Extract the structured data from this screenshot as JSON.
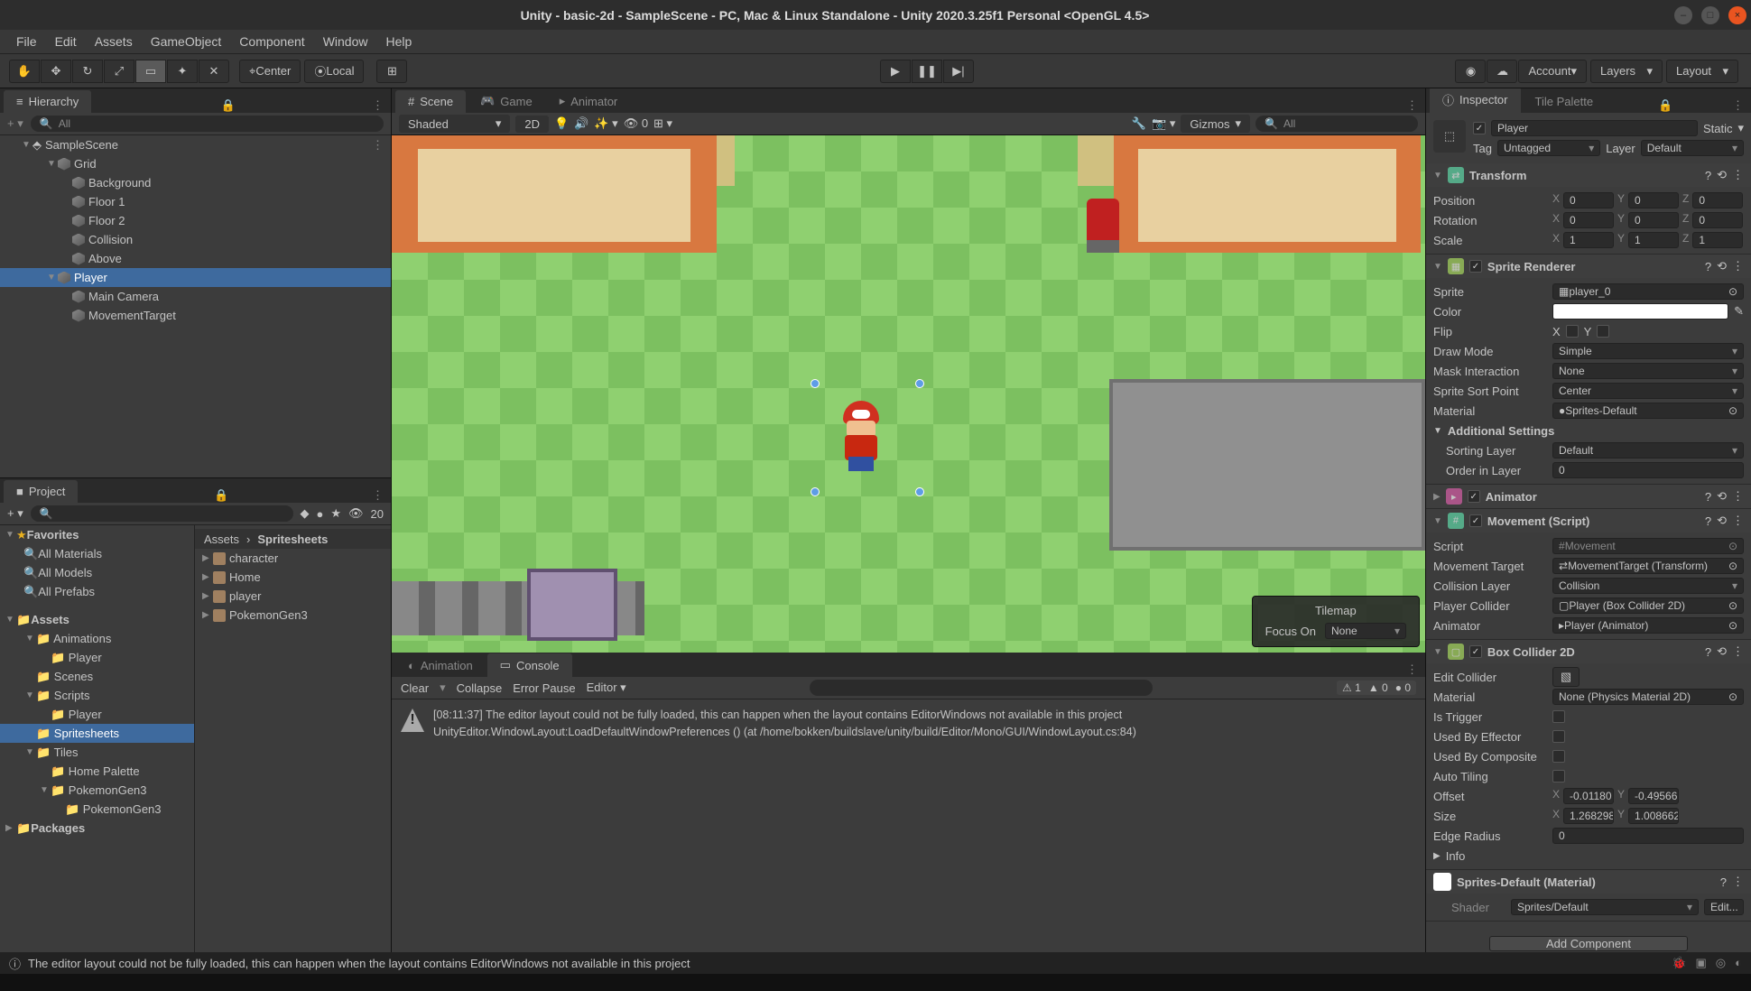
{
  "window": {
    "title": "Unity - basic-2d - SampleScene - PC, Mac & Linux Standalone - Unity 2020.3.25f1 Personal <OpenGL 4.5>"
  },
  "menu": [
    "File",
    "Edit",
    "Assets",
    "GameObject",
    "Component",
    "Window",
    "Help"
  ],
  "toolbar": {
    "pivot_center": "Center",
    "pivot_local": "Local",
    "account": "Account",
    "layers": "Layers",
    "layout": "Layout"
  },
  "hierarchy": {
    "tab": "Hierarchy",
    "search_placeholder": "All",
    "root": "SampleScene",
    "nodes": [
      {
        "name": "Grid",
        "depth": 1,
        "foldout": "▼"
      },
      {
        "name": "Background",
        "depth": 2
      },
      {
        "name": "Floor 1",
        "depth": 2
      },
      {
        "name": "Floor 2",
        "depth": 2
      },
      {
        "name": "Collision",
        "depth": 2
      },
      {
        "name": "Above",
        "depth": 2
      },
      {
        "name": "Player",
        "depth": 1,
        "foldout": "▼",
        "sel": true
      },
      {
        "name": "Main Camera",
        "depth": 2
      },
      {
        "name": "MovementTarget",
        "depth": 2
      }
    ]
  },
  "sceneTabs": {
    "scene": "Scene",
    "game": "Game",
    "animator": "Animator"
  },
  "sceneTb": {
    "shaded": "Shaded",
    "mode2d": "2D",
    "count": "0",
    "gizmos": "Gizmos",
    "search_placeholder": "All"
  },
  "tilemapPopup": {
    "title": "Tilemap",
    "focus": "Focus On",
    "value": "None"
  },
  "bottomTabs": {
    "animation": "Animation",
    "console": "Console"
  },
  "project": {
    "tab": "Project",
    "hidden": "20",
    "favorites": "Favorites",
    "fav_items": [
      "All Materials",
      "All Models",
      "All Prefabs"
    ],
    "assets": "Assets",
    "tree": [
      {
        "name": "Animations",
        "depth": 1,
        "foldout": "▼"
      },
      {
        "name": "Player",
        "depth": 2
      },
      {
        "name": "Scenes",
        "depth": 1
      },
      {
        "name": "Scripts",
        "depth": 1,
        "foldout": "▼"
      },
      {
        "name": "Player",
        "depth": 2
      },
      {
        "name": "Spritesheets",
        "depth": 1,
        "sel": true
      },
      {
        "name": "Tiles",
        "depth": 1,
        "foldout": "▼"
      },
      {
        "name": "Home Palette",
        "depth": 2
      },
      {
        "name": "PokemonGen3",
        "depth": 2,
        "foldout": "▼"
      },
      {
        "name": "PokemonGen3",
        "depth": 3
      }
    ],
    "packages": "Packages",
    "crumb_assets": "Assets",
    "crumb_folder": "Spritesheets",
    "items": [
      "character",
      "Home",
      "player",
      "PokemonGen3"
    ]
  },
  "console": {
    "clear": "Clear",
    "collapse": "Collapse",
    "error_pause": "Error Pause",
    "editor": "Editor",
    "counts": {
      "warn": "1",
      "info": "0",
      "error": "0"
    },
    "msg_time": "[08:11:37]",
    "msg_line1": "The editor layout could not be fully loaded, this can happen when the layout contains EditorWindows not available in this project",
    "msg_line2": "UnityEditor.WindowLayout:LoadDefaultWindowPreferences () (at /home/bokken/buildslave/unity/build/Editor/Mono/GUI/WindowLayout.cs:84)"
  },
  "inspector": {
    "tab": "Inspector",
    "tilepalette": "Tile Palette",
    "name": "Player",
    "static": "Static",
    "tag_label": "Tag",
    "tag": "Untagged",
    "layer_label": "Layer",
    "layer": "Default",
    "transform": {
      "title": "Transform",
      "position": "Position",
      "rotation": "Rotation",
      "scale": "Scale",
      "pos": {
        "x": "0",
        "y": "0",
        "z": "0"
      },
      "rot": {
        "x": "0",
        "y": "0",
        "z": "0"
      },
      "scl": {
        "x": "1",
        "y": "1",
        "z": "1"
      }
    },
    "sprite": {
      "title": "Sprite Renderer",
      "sprite_label": "Sprite",
      "sprite": "player_0",
      "color_label": "Color",
      "flip_label": "Flip",
      "flip_x": "X",
      "flip_y": "Y",
      "drawmode_label": "Draw Mode",
      "drawmode": "Simple",
      "mask_label": "Mask Interaction",
      "mask": "None",
      "sort_label": "Sprite Sort Point",
      "sort": "Center",
      "material_label": "Material",
      "material": "Sprites-Default",
      "add_label": "Additional Settings",
      "sortlayer_label": "Sorting Layer",
      "sortlayer": "Default",
      "order_label": "Order in Layer",
      "order": "0"
    },
    "animator": {
      "title": "Animator"
    },
    "movement": {
      "title": "Movement (Script)",
      "script_label": "Script",
      "script": "Movement",
      "target_label": "Movement Target",
      "target": "MovementTarget (Transform)",
      "coll_label": "Collision Layer",
      "coll": "Collision",
      "pcoll_label": "Player Collider",
      "pcoll": "Player (Box Collider 2D)",
      "anim_label": "Animator",
      "anim": "Player (Animator)"
    },
    "box": {
      "title": "Box Collider 2D",
      "edit_label": "Edit Collider",
      "material_label": "Material",
      "material": "None (Physics Material 2D)",
      "trigger_label": "Is Trigger",
      "effector_label": "Used By Effector",
      "composite_label": "Used By Composite",
      "autotile_label": "Auto Tiling",
      "offset_label": "Offset",
      "offset": {
        "x": "-0.01180",
        "y": "-0.49566"
      },
      "size_label": "Size",
      "size": {
        "x": "1.268298",
        "y": "1.008662"
      },
      "edge_label": "Edge Radius",
      "edge": "0",
      "info_label": "Info"
    },
    "material_slot": {
      "name": "Sprites-Default (Material)",
      "shader_label": "Shader",
      "shader": "Sprites/Default",
      "edit": "Edit..."
    },
    "add_component": "Add Component"
  },
  "status": {
    "msg": "The editor layout could not be fully loaded, this can happen when the layout contains EditorWindows not available in this project"
  }
}
